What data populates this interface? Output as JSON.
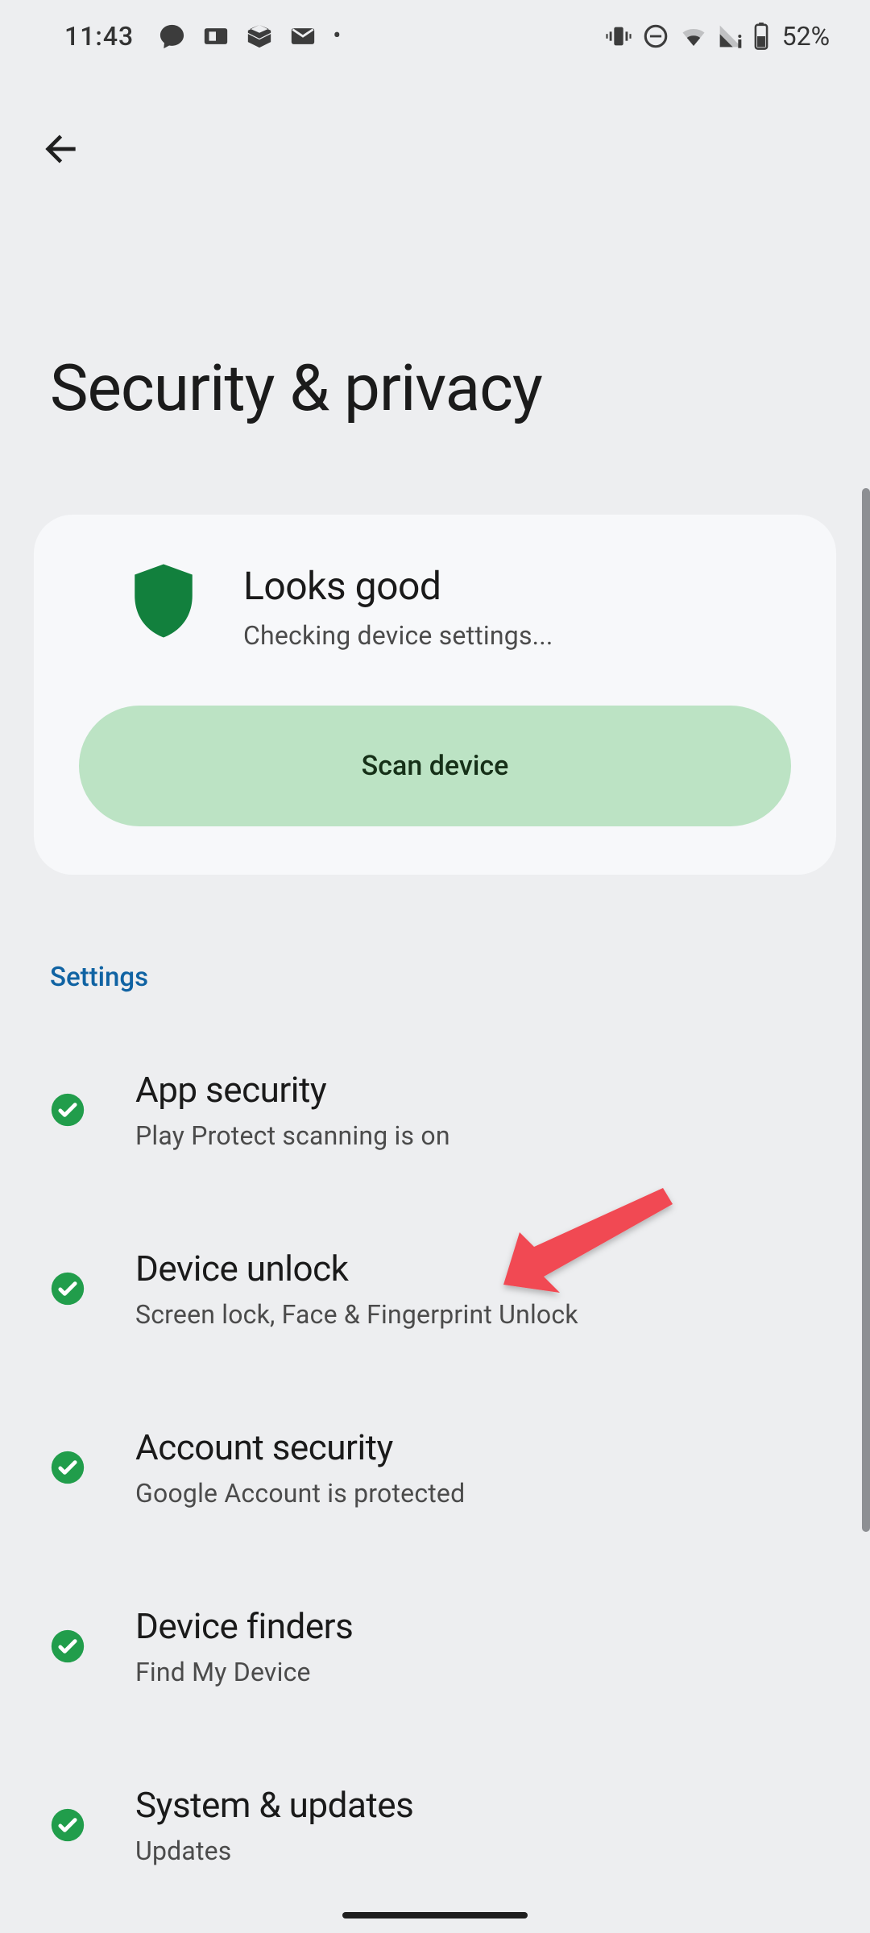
{
  "status_bar": {
    "time": "11:43",
    "battery_pct": "52%"
  },
  "page": {
    "title": "Security & privacy"
  },
  "status_card": {
    "title": "Looks good",
    "subtitle": "Checking device settings...",
    "scan_label": "Scan device"
  },
  "section_header": "Settings",
  "settings": [
    {
      "title": "App security",
      "subtitle": "Play Protect scanning is on"
    },
    {
      "title": "Device unlock",
      "subtitle": "Screen lock, Face & Fingerprint Unlock"
    },
    {
      "title": "Account security",
      "subtitle": "Google Account is protected"
    },
    {
      "title": "Device finders",
      "subtitle": "Find My Device"
    },
    {
      "title": "System & updates",
      "subtitle": "Updates"
    }
  ]
}
